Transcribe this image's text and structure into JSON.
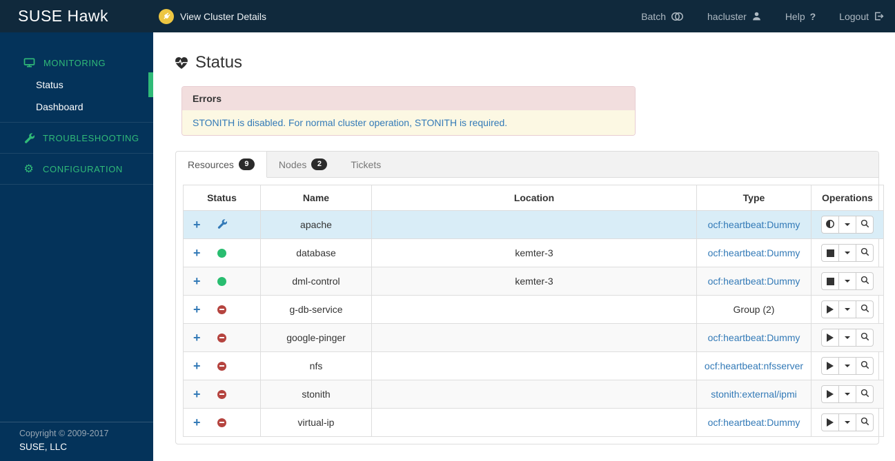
{
  "topbar": {
    "logo": "SUSE Hawk",
    "cluster_details_label": "View Cluster Details",
    "batch_label": "Batch",
    "user_label": "hacluster",
    "help_label": "Help",
    "help_glyph": "?",
    "logout_label": "Logout"
  },
  "sidebar": {
    "monitoring_label": "MONITORING",
    "status_label": "Status",
    "dashboard_label": "Dashboard",
    "troubleshooting_label": "TROUBLESHOOTING",
    "configuration_label": "CONFIGURATION",
    "footer_line1": "Copyright © 2009-2017",
    "footer_line2": "SUSE, LLC"
  },
  "main": {
    "heading": "Status",
    "alert": {
      "title": "Errors",
      "message": "STONITH is disabled. For normal cluster operation, STONITH is required."
    },
    "tabs": [
      {
        "label": "Resources",
        "badge": "9",
        "active": true
      },
      {
        "label": "Nodes",
        "badge": "2",
        "active": false
      },
      {
        "label": "Tickets",
        "badge": "",
        "active": false
      }
    ],
    "table": {
      "headers": [
        "Status",
        "Name",
        "Location",
        "Type",
        "Operations"
      ],
      "rows": [
        {
          "name": "apache",
          "status": "maintenance",
          "location": "",
          "type": "ocf:heartbeat:Dummy",
          "type_is_link": true,
          "operation": "toggle",
          "highlighted": true
        },
        {
          "name": "database",
          "status": "running",
          "location": "kemter-3",
          "type": "ocf:heartbeat:Dummy",
          "type_is_link": true,
          "operation": "stop",
          "highlighted": false
        },
        {
          "name": "dml-control",
          "status": "running",
          "location": "kemter-3",
          "type": "ocf:heartbeat:Dummy",
          "type_is_link": true,
          "operation": "stop",
          "highlighted": false
        },
        {
          "name": "g-db-service",
          "status": "stopped",
          "location": "",
          "type": "Group (2)",
          "type_is_link": false,
          "operation": "start",
          "highlighted": false
        },
        {
          "name": "google-pinger",
          "status": "stopped",
          "location": "",
          "type": "ocf:heartbeat:Dummy",
          "type_is_link": true,
          "operation": "start",
          "highlighted": false
        },
        {
          "name": "nfs",
          "status": "stopped",
          "location": "",
          "type": "ocf:heartbeat:nfsserver",
          "type_is_link": true,
          "operation": "start",
          "highlighted": false
        },
        {
          "name": "stonith",
          "status": "stopped",
          "location": "",
          "type": "stonith:external/ipmi",
          "type_is_link": true,
          "operation": "start",
          "highlighted": false
        },
        {
          "name": "virtual-ip",
          "status": "stopped",
          "location": "",
          "type": "ocf:heartbeat:Dummy",
          "type_is_link": true,
          "operation": "start",
          "highlighted": false
        }
      ]
    }
  },
  "colors": {
    "accent_green": "#30ba78",
    "link_blue": "#337ab7",
    "running_green": "#29bd70",
    "stopped_red": "#b5443f",
    "topbar_bg": "#10293c",
    "sidebar_bg": "#04335a",
    "highlight_row": "#d9edf7",
    "alert_header_bg": "#f2dede",
    "alert_body_bg": "#fcf8e3"
  }
}
